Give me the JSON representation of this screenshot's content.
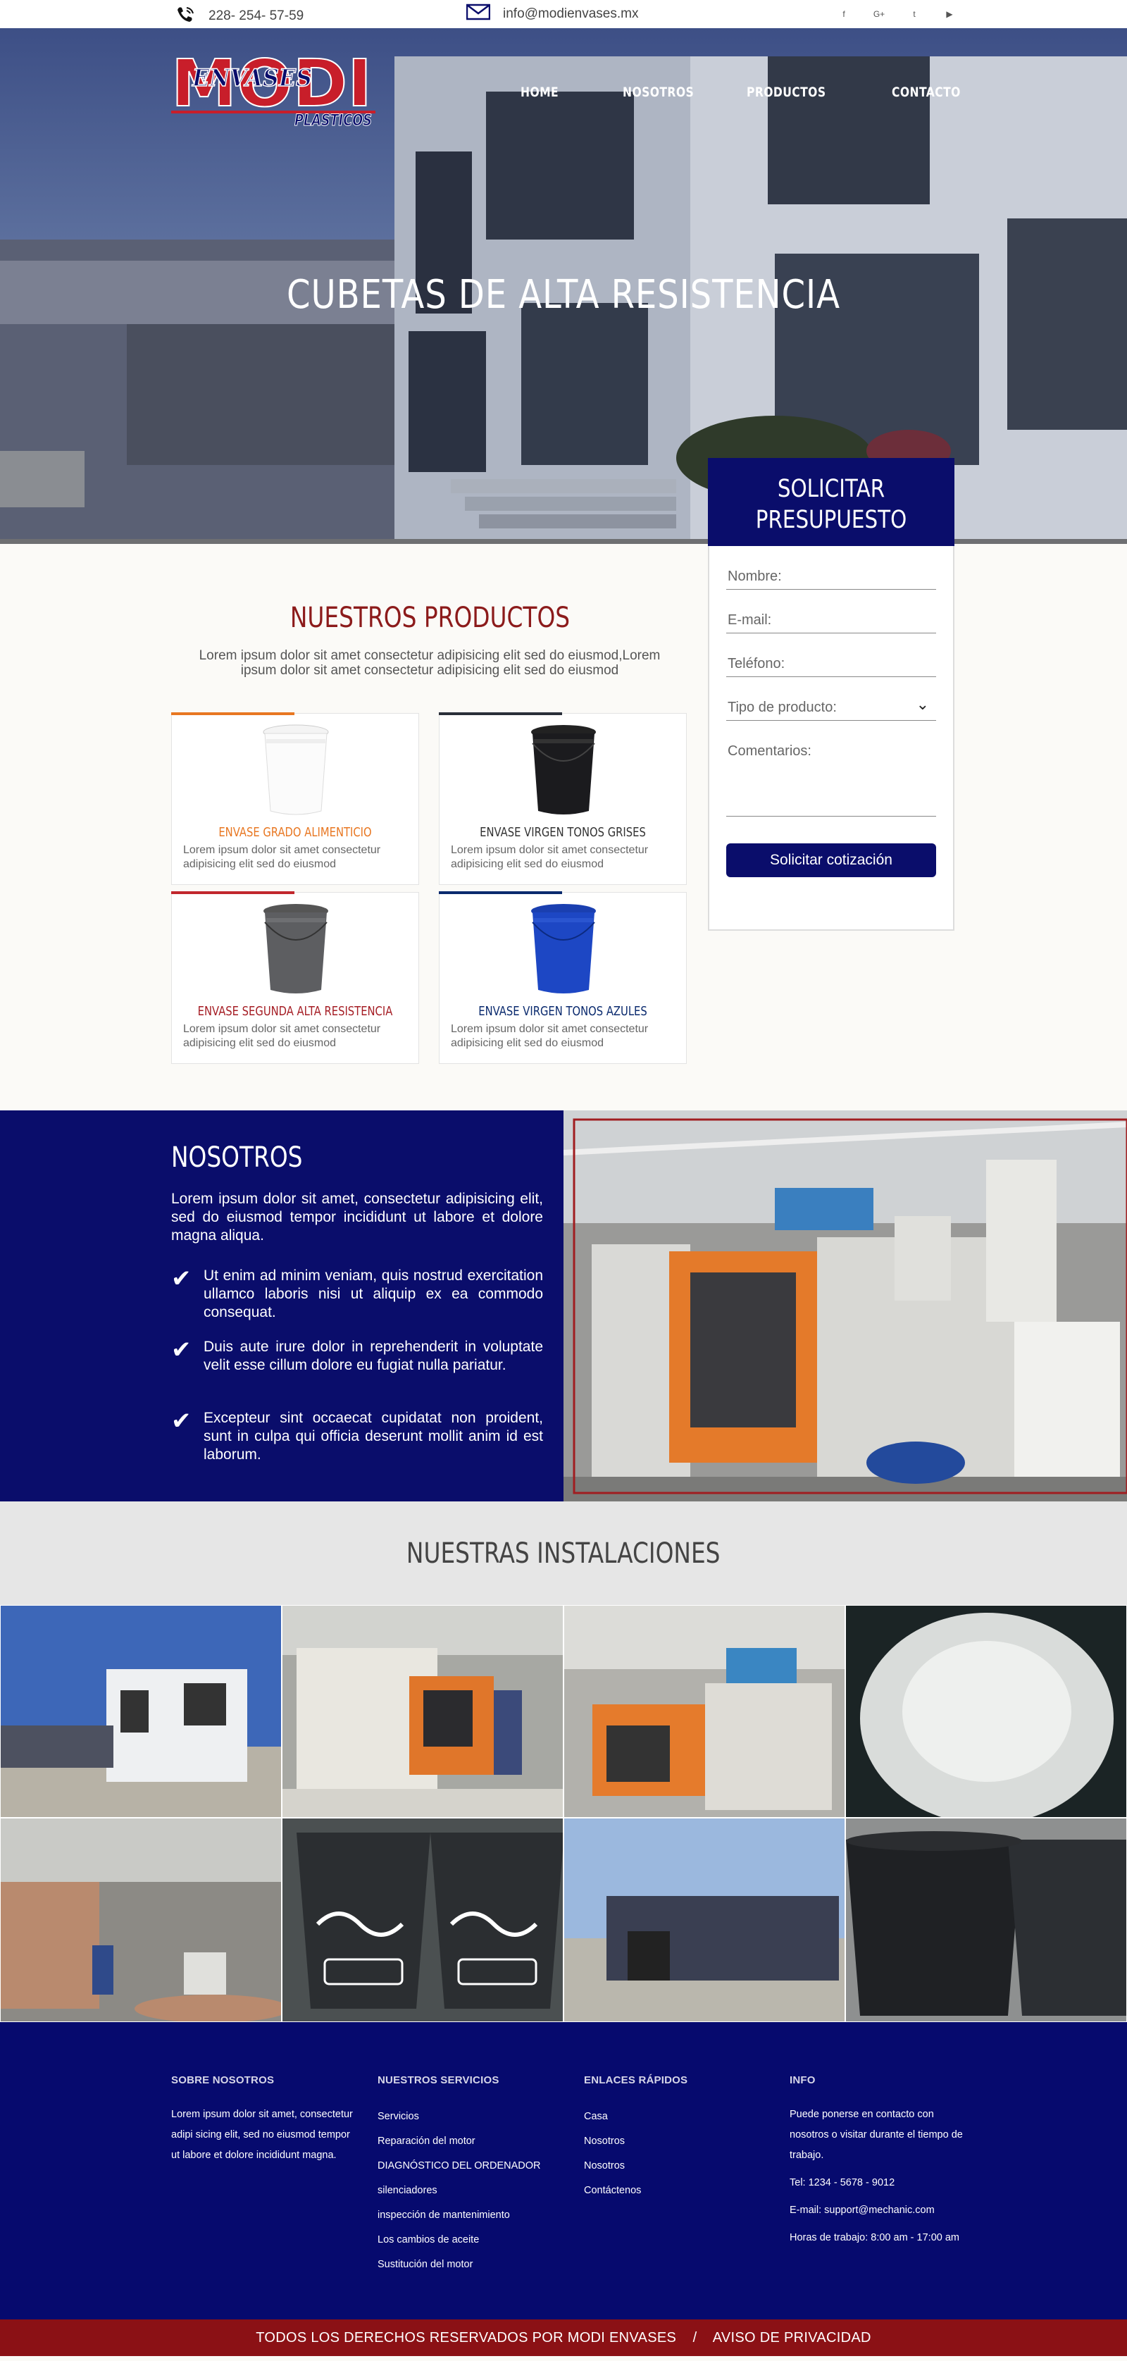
{
  "topbar": {
    "phone": "228- 254- 57-59",
    "email": "info@modienvases.mx",
    "social_icons": [
      "f",
      "G+",
      "t",
      "▶"
    ]
  },
  "logo": {
    "line1": "MODI",
    "line2": "ENVASES",
    "line3": "PLASTICOS"
  },
  "nav": {
    "home": "HOME",
    "nosotros": "NOSOTROS",
    "productos": "PRODUCTOS",
    "contacto": "CONTACTO"
  },
  "hero": {
    "title": "CUBETAS DE ALTA RESISTENCIA"
  },
  "quote": {
    "title_line1": "SOLICITAR",
    "title_line2": "PRESUPUESTO",
    "name_placeholder": "Nombre:",
    "email_placeholder": "E-mail:",
    "phone_placeholder": "Teléfono:",
    "product_select": "Tipo de producto:",
    "comments_placeholder": "Comentarios:",
    "submit": "Solicitar  cotización"
  },
  "products": {
    "title": "NUESTROS PRODUCTOS",
    "intro": "Lorem ipsum dolor sit amet consectetur adipisicing elit sed do eiusmod,Lorem ipsum dolor sit amet consectetur adipisicing elit sed do eiusmod",
    "items": [
      {
        "name": "ENVASE GRADO ALIMENTICIO",
        "desc": "Lorem ipsum dolor sit amet consectetur adipisicing elit sed do eiusmod",
        "color": "#e87722"
      },
      {
        "name": "ENVASE VIRGEN TONOS GRISES",
        "desc": "Lorem ipsum dolor sit amet consectetur adipisicing elit sed do eiusmod",
        "color": "#2a2f3a"
      },
      {
        "name": "ENVASE SEGUNDA ALTA RESISTENCIA",
        "desc": "Lorem ipsum dolor sit amet consectetur adipisicing elit sed do eiusmod",
        "color": "#c1272d"
      },
      {
        "name": "ENVASE VIRGEN TONOS AZULES",
        "desc": "Lorem ipsum dolor sit amet consectetur adipisicing elit sed do eiusmod",
        "color": "#0a2a6e"
      }
    ]
  },
  "nosotros": {
    "title": "NOSOTROS",
    "intro": "Lorem ipsum dolor sit amet, consectetur adipisicing elit, sed do eiusmod tempor incididunt ut labore et dolore magna aliqua.",
    "bullets": [
      "Ut enim ad minim veniam, quis nostrud exercitation ullamco laboris nisi ut aliquip ex ea commodo consequat.",
      "Duis aute irure dolor in reprehenderit in voluptate velit esse cillum dolore eu fugiat nulla pariatur.",
      "Excepteur sint occaecat cupidatat non proident, sunt in culpa qui officia deserunt mollit anim id est laborum."
    ]
  },
  "instalaciones": {
    "title": "NUESTRAS INSTALACIONES"
  },
  "footer": {
    "col1": {
      "title": "SOBRE NOSOTROS",
      "text": "Lorem ipsum dolor sit amet, consectetur adipi sicing elit, sed no eiusmod tempor ut labore et dolore incididunt magna."
    },
    "col2": {
      "title": "NUESTROS SERVICIOS",
      "items": [
        "Servicios",
        "Reparación del motor",
        "DIAGNÓSTICO DEL ORDENADOR",
        "silenciadores",
        "inspección de mantenimiento",
        "Los cambios de aceite",
        "Sustitución del motor"
      ]
    },
    "col3": {
      "title": "ENLACES RÁPIDOS",
      "items": [
        "Casa",
        "Nosotros",
        "Nosotros",
        "Contáctenos"
      ]
    },
    "col4": {
      "title": "INFO",
      "text": "Puede ponerse en contacto con nosotros o visitar durante el tiempo de trabajo.",
      "tel": "Tel: 1234 - 5678 - 9012",
      "email": "E-mail: support@mechanic.com",
      "hours": "Horas de trabajo: 8:00 am - 17:00 am"
    }
  },
  "bottom": {
    "rights": "TODOS LOS DERECHOS RESERVADOS POR MODI ENVASES",
    "separator": "/",
    "privacy": "AVISO DE PRIVACIDAD"
  },
  "colors": {
    "navy": "#0a0d6b",
    "footer_navy": "#060a6e",
    "red": "#8b1115",
    "title_red": "#8c1b1b"
  }
}
